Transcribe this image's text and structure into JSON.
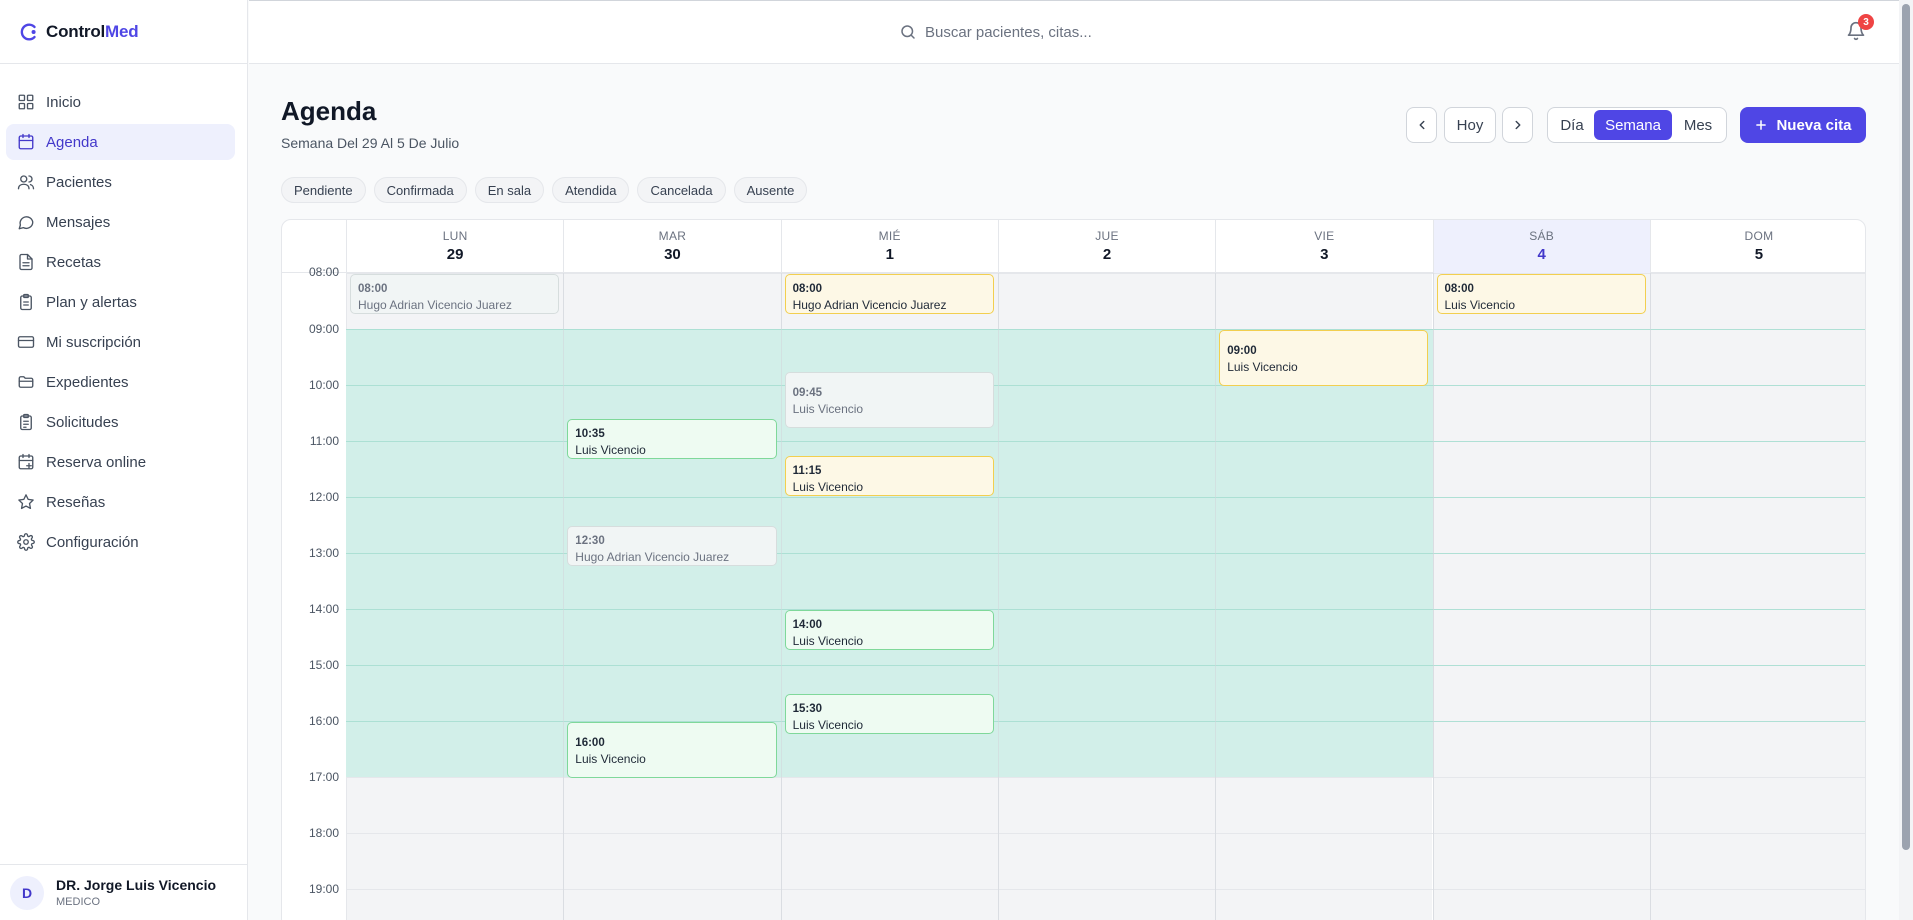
{
  "app": {
    "brand_part1": "Control",
    "brand_part2": "Med"
  },
  "sidebar": {
    "items": [
      {
        "label": "Inicio",
        "icon": "grid-icon"
      },
      {
        "label": "Agenda",
        "icon": "calendar-icon"
      },
      {
        "label": "Pacientes",
        "icon": "users-icon"
      },
      {
        "label": "Mensajes",
        "icon": "chat-icon"
      },
      {
        "label": "Recetas",
        "icon": "document-icon"
      },
      {
        "label": "Plan y alertas",
        "icon": "clipboard-icon"
      },
      {
        "label": "Mi suscripción",
        "icon": "credit-card-icon"
      },
      {
        "label": "Expedientes",
        "icon": "folder-icon"
      },
      {
        "label": "Solicitudes",
        "icon": "clipboard-check-icon"
      },
      {
        "label": "Reserva online",
        "icon": "calendar-plus-icon"
      },
      {
        "label": "Reseñas",
        "icon": "star-icon"
      },
      {
        "label": "Configuración",
        "icon": "gear-icon"
      }
    ],
    "active_index": 1
  },
  "user": {
    "initial": "D",
    "name": "DR. Jorge Luis Vicencio",
    "role": "MEDICO"
  },
  "topbar": {
    "search_placeholder": "Buscar pacientes, citas...",
    "notifications_count": "3"
  },
  "header": {
    "title": "Agenda",
    "subtitle": "Semana Del 29 Al 5 De Julio",
    "today_label": "Hoy",
    "views": [
      "Día",
      "Semana",
      "Mes"
    ],
    "active_view": "Semana",
    "new_button_label": "Nueva cita"
  },
  "filters": [
    "Pendiente",
    "Confirmada",
    "En sala",
    "Atendida",
    "Cancelada",
    "Ausente"
  ],
  "calendar": {
    "days": [
      {
        "name": "LUN",
        "date": "29"
      },
      {
        "name": "MAR",
        "date": "30"
      },
      {
        "name": "MIÉ",
        "date": "1"
      },
      {
        "name": "JUE",
        "date": "2"
      },
      {
        "name": "VIE",
        "date": "3"
      },
      {
        "name": "SÁB",
        "date": "4",
        "today": true
      },
      {
        "name": "DOM",
        "date": "5"
      }
    ],
    "hours": [
      "08:00",
      "09:00",
      "10:00",
      "11:00",
      "12:00",
      "13:00",
      "14:00",
      "15:00",
      "16:00",
      "17:00",
      "18:00",
      "19:00"
    ],
    "events": [
      {
        "day": 0,
        "time": "08:00",
        "patient": "Hugo Adrian Vicencio Juarez",
        "status": "cancelada"
      },
      {
        "day": 2,
        "time": "08:00",
        "patient": "Hugo Adrian Vicencio Juarez",
        "status": "confirmada"
      },
      {
        "day": 5,
        "time": "08:00",
        "patient": "Luis Vicencio",
        "status": "confirmada"
      },
      {
        "day": 4,
        "time": "09:00",
        "patient": "Luis Vicencio",
        "status": "confirmada"
      },
      {
        "day": 2,
        "time": "09:45",
        "patient": "Luis Vicencio",
        "status": "cancelada"
      },
      {
        "day": 1,
        "time": "10:35",
        "patient": "Luis Vicencio",
        "status": "atendida"
      },
      {
        "day": 2,
        "time": "11:15",
        "patient": "Luis Vicencio",
        "status": "confirmada"
      },
      {
        "day": 1,
        "time": "12:30",
        "patient": "Hugo Adrian Vicencio Juarez",
        "status": "cancelada"
      },
      {
        "day": 2,
        "time": "14:00",
        "patient": "Luis Vicencio",
        "status": "atendida"
      },
      {
        "day": 2,
        "time": "15:30",
        "patient": "Luis Vicencio",
        "status": "atendida"
      },
      {
        "day": 1,
        "time": "16:00",
        "patient": "Luis Vicencio",
        "status": "atendida"
      }
    ]
  },
  "colors": {
    "accent": "#4f46e5",
    "available": "#d2efe9",
    "confirmada": "#f2cf4f",
    "atendida": "#7fd89a",
    "cancelada": "#d6dddd"
  }
}
